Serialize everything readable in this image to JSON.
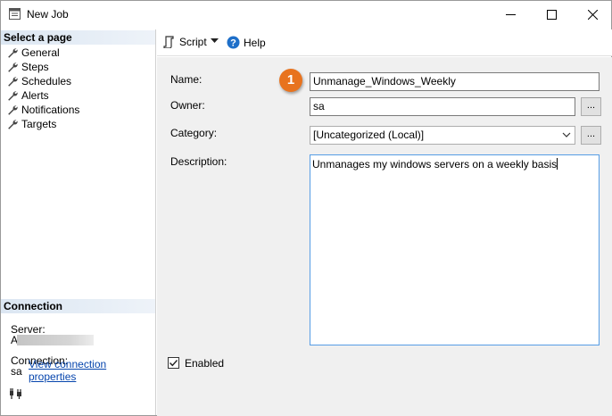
{
  "window": {
    "title": "New Job",
    "controls": {
      "minimize": "minimize",
      "maximize": "maximize",
      "close": "close"
    }
  },
  "left_panel": {
    "select_page_header": "Select a page",
    "pages": [
      {
        "label": "General",
        "icon": "wrench-icon"
      },
      {
        "label": "Steps",
        "icon": "wrench-icon"
      },
      {
        "label": "Schedules",
        "icon": "wrench-icon"
      },
      {
        "label": "Alerts",
        "icon": "wrench-icon"
      },
      {
        "label": "Notifications",
        "icon": "wrench-icon"
      },
      {
        "label": "Targets",
        "icon": "wrench-icon"
      }
    ],
    "connection_header": "Connection",
    "server_label": "Server:",
    "server_value": "A",
    "connection_label": "Connection:",
    "connection_value": "sa",
    "view_connection_link": "View connection properties"
  },
  "toolbar": {
    "script_label": "Script",
    "help_label": "Help"
  },
  "form": {
    "name_label": "Name:",
    "name_value": "Unmanage_Windows_Weekly",
    "owner_label": "Owner:",
    "owner_value": "sa",
    "owner_browse": "...",
    "category_label": "Category:",
    "category_value": "[Uncategorized (Local)]",
    "category_browse": "...",
    "description_label": "Description:",
    "description_value": "Unmanages my windows servers on a weekly basis",
    "enabled_label": "Enabled",
    "enabled_checked": true
  },
  "annotation": {
    "step_number": "1",
    "color": "#e8731e"
  },
  "colors": {
    "section_header_bg": "#dbe6f2",
    "link": "#0645ad",
    "focus_border": "#569de5"
  }
}
